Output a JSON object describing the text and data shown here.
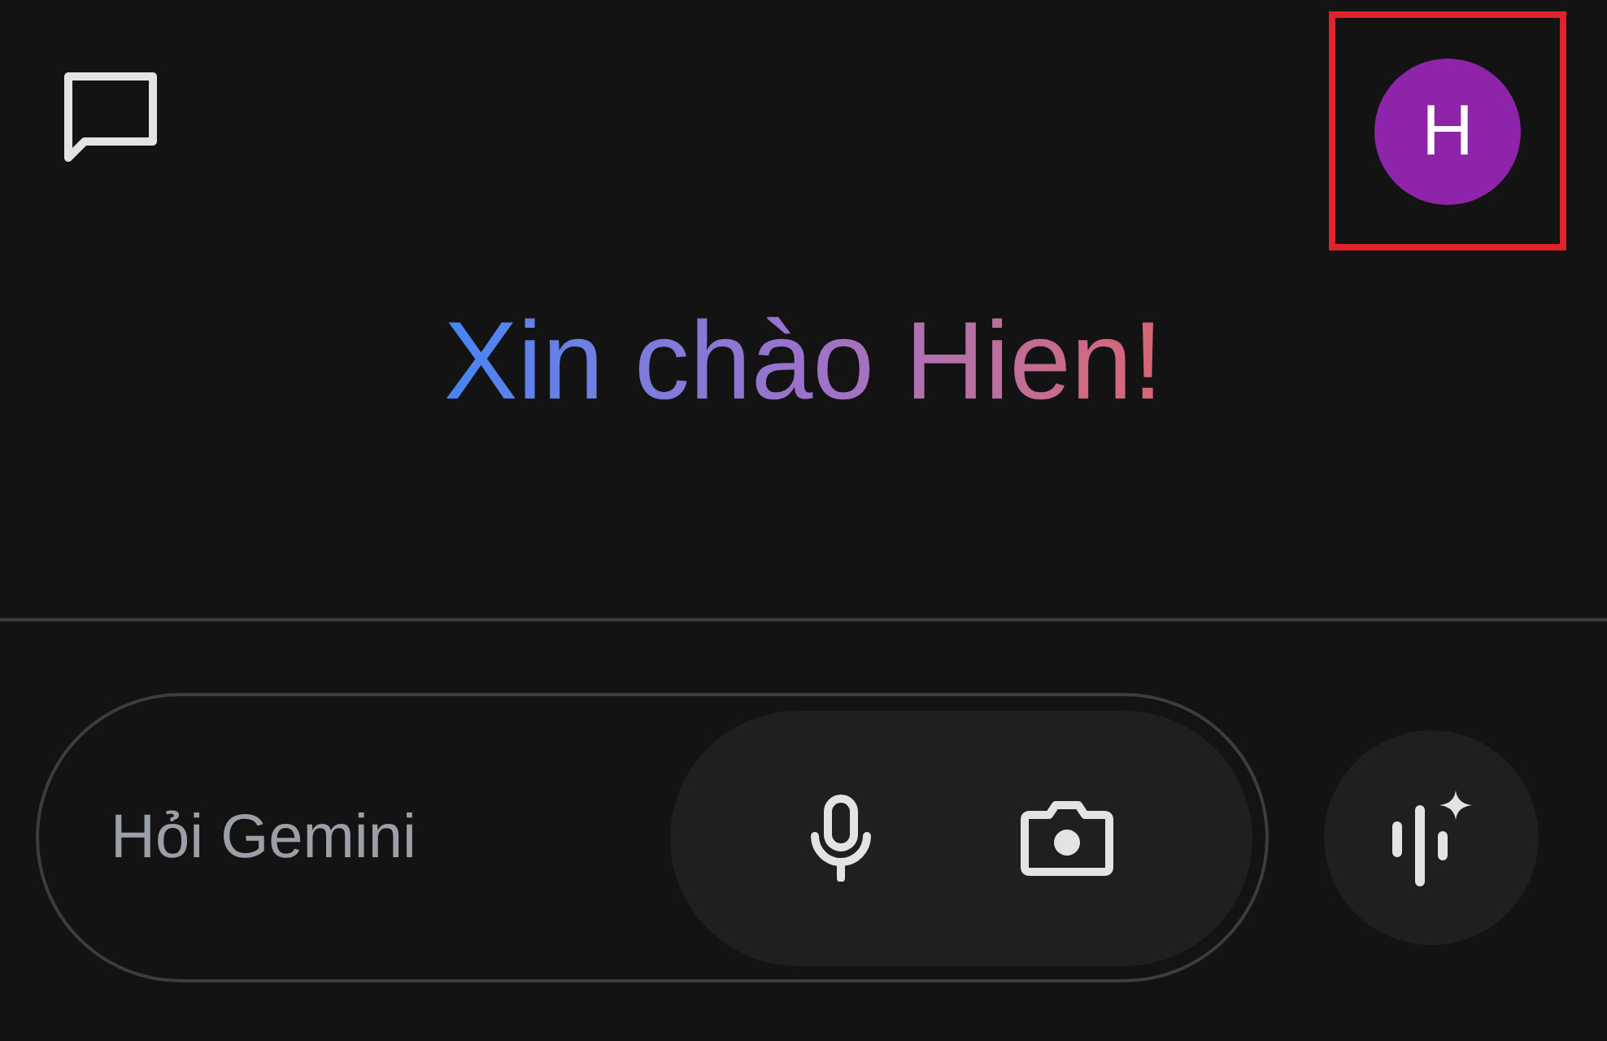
{
  "header": {
    "avatar": {
      "initial": "H",
      "highlighted": true
    }
  },
  "greeting": "Xin chào Hien!",
  "prompt": {
    "placeholder": "Hỏi Gemini"
  }
}
